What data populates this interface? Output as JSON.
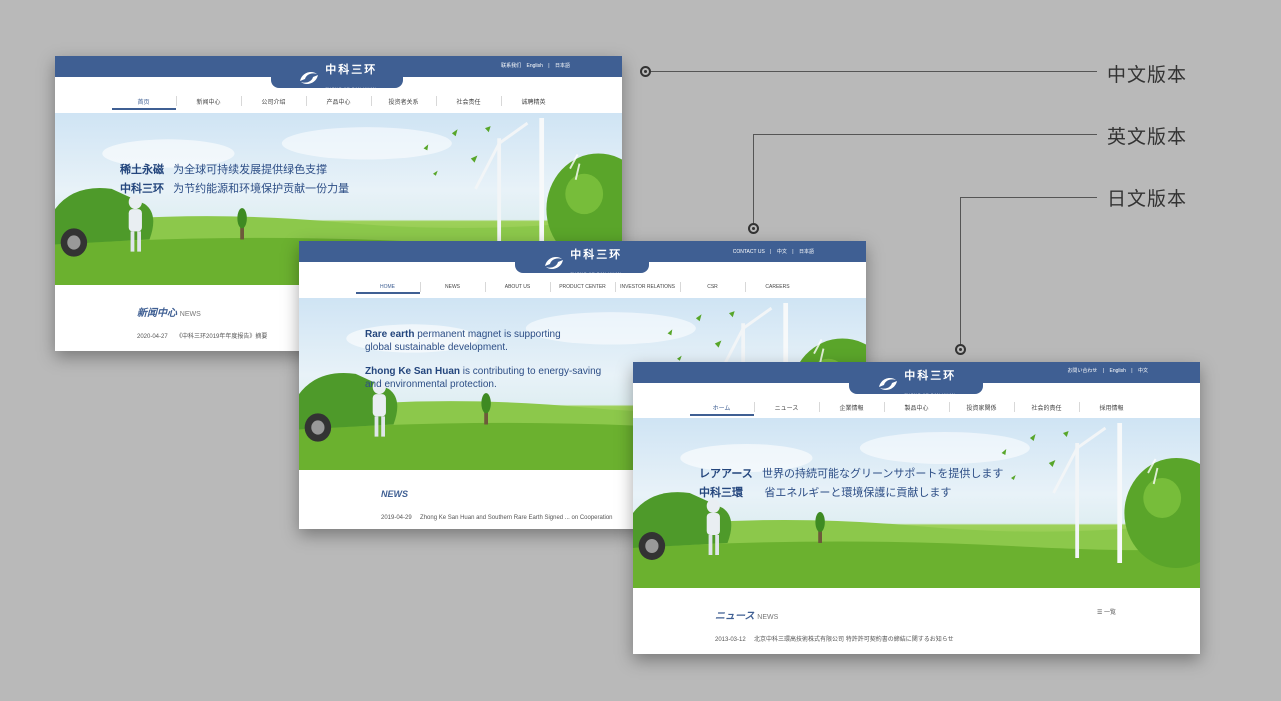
{
  "callouts": {
    "chinese": "中文版本",
    "english": "英文版本",
    "japanese": "日文版本"
  },
  "brand": {
    "name_cn": "中科三环",
    "name_en": "ZHONG KE SAN HUAN",
    "primary_color": "#3f5f93"
  },
  "cn_site": {
    "top_links": [
      "联系我们",
      "English",
      "|",
      "日本語"
    ],
    "nav": [
      "首页",
      "新闻中心",
      "公司介绍",
      "产品中心",
      "投资者关系",
      "社会责任",
      "诚聘精英"
    ],
    "slogan_line1_bold": "稀土永磁",
    "slogan_line1": "为全球可持续发展提供绿色支撑",
    "slogan_line2_bold": "中科三环",
    "slogan_line2": "为节约能源和环境保护贡献一份力量",
    "news_title": "新闻中心",
    "news_en": "NEWS",
    "news_date": "2020-04-27",
    "news_item": "《中科三环2019年年度报告》摘要"
  },
  "en_site": {
    "top_links": [
      "CONTACT US",
      "|",
      "中文",
      "|",
      "日本語"
    ],
    "nav": [
      "HOME",
      "NEWS",
      "ABOUT US",
      "PRODUCT CENTER",
      "INVESTOR RELATIONS",
      "CSR",
      "CAREERS"
    ],
    "slogan_line1_bold": "Rare earth",
    "slogan_line1": "permanent magnet is supporting",
    "slogan_line1b": "global sustainable development.",
    "slogan_line2_bold": "Zhong Ke San Huan",
    "slogan_line2": "is contributing to energy-saving",
    "slogan_line2b": "and environmental protection.",
    "news_title": "NEWS",
    "news_date": "2019-04-29",
    "news_item": "Zhong Ke San Huan and Southern Rare Earth Signed ... on Cooperation"
  },
  "jp_site": {
    "top_links": [
      "お問い合わせ",
      "|",
      "English",
      "|",
      "中文"
    ],
    "nav": [
      "ホーム",
      "ニュース",
      "企業情報",
      "製品中心",
      "投資家関係",
      "社会的責任",
      "採用情報"
    ],
    "slogan_line1_bold": "レアアース",
    "slogan_line1": "世界の持続可能なグリーンサポートを提供します",
    "slogan_line2_bold": "中科三環",
    "slogan_line2": "省エネルギーと環境保護に貢献します",
    "news_title": "ニュース",
    "news_en": "NEWS",
    "news_more": "☰ 一覧",
    "news_date": "2013-03-12",
    "news_item": "北京中科三環高技術株式有限公司 特許許可契約書の締結に関するお知らせ"
  }
}
